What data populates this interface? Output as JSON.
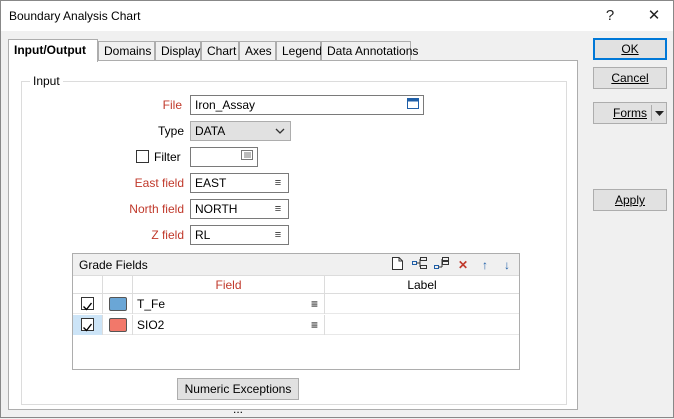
{
  "window": {
    "title": "Boundary Analysis Chart",
    "help_glyph": "?",
    "close_glyph": "✕"
  },
  "tabs": [
    {
      "label": "Input/Output",
      "active": true
    },
    {
      "label": "Domains"
    },
    {
      "label": "Display"
    },
    {
      "label": "Chart"
    },
    {
      "label": "Axes"
    },
    {
      "label": "Legend"
    },
    {
      "label": "Data Annotations"
    }
  ],
  "input_group": {
    "legend": "Input",
    "file": {
      "label": "File",
      "value": "Iron_Assay"
    },
    "type": {
      "label": "Type",
      "value": "DATA"
    },
    "filter": {
      "label": "Filter",
      "checked": false,
      "value": ""
    },
    "east": {
      "label": "East field",
      "value": "EAST"
    },
    "north": {
      "label": "North field",
      "value": "NORTH"
    },
    "z": {
      "label": "Z field",
      "value": "RL"
    }
  },
  "grade_fields": {
    "title": "Grade Fields",
    "columns": {
      "field": "Field",
      "label": "Label"
    },
    "rows": [
      {
        "checked": true,
        "color": "#6aa6d6",
        "field": "T_Fe",
        "label": ""
      },
      {
        "checked": true,
        "color": "#f2786a",
        "field": "SIO2",
        "label": ""
      }
    ],
    "tools": [
      "new-icon",
      "insert-before-icon",
      "insert-after-icon",
      "delete-icon",
      "move-up-icon",
      "move-down-icon"
    ]
  },
  "numeric_exceptions_label": "Numeric Exceptions ...",
  "side_buttons": {
    "ok": "OK",
    "cancel": "Cancel",
    "forms": "Forms",
    "apply": "Apply"
  }
}
